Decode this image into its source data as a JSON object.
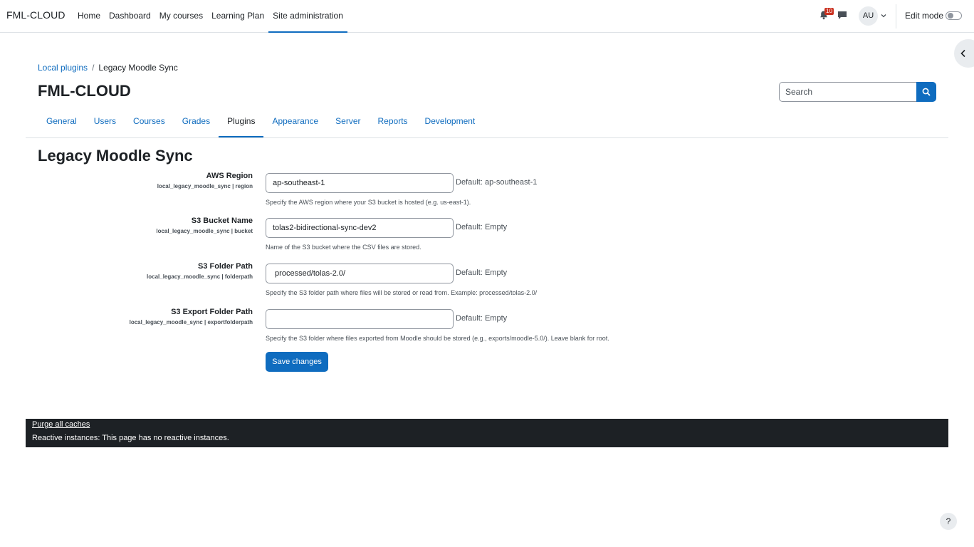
{
  "navbar": {
    "brand": "FML-CLOUD",
    "items": [
      {
        "label": "Home"
      },
      {
        "label": "Dashboard"
      },
      {
        "label": "My courses"
      },
      {
        "label": "Learning Plan"
      },
      {
        "label": "Site administration"
      }
    ],
    "active_item": "Site administration",
    "notification_count": "10",
    "avatar_initials": "AU",
    "edit_mode_label": "Edit mode",
    "icons": [
      "bell-icon",
      "chat-icon",
      "chevron-down-icon",
      "chevron-left-icon"
    ]
  },
  "breadcrumb": {
    "parent": "Local plugins",
    "current": "Legacy Moodle Sync"
  },
  "header": {
    "site_title": "FML-CLOUD"
  },
  "search": {
    "placeholder": "Search"
  },
  "tabs": [
    {
      "label": "General"
    },
    {
      "label": "Users"
    },
    {
      "label": "Courses"
    },
    {
      "label": "Grades"
    },
    {
      "label": "Plugins"
    },
    {
      "label": "Appearance"
    },
    {
      "label": "Server"
    },
    {
      "label": "Reports"
    },
    {
      "label": "Development"
    }
  ],
  "active_tab": "Plugins",
  "page_heading": "Legacy Moodle Sync",
  "settings": [
    {
      "title": "AWS Region",
      "key": "local_legacy_moodle_sync | region",
      "value": "ap-southeast-1",
      "default": "Default: ap-southeast-1",
      "description": "Specify the AWS region where your S3 bucket is hosted (e.g. us-east-1)."
    },
    {
      "title": "S3 Bucket Name",
      "key": "local_legacy_moodle_sync | bucket",
      "value": "tolas2-bidirectional-sync-dev2",
      "default": "Default: Empty",
      "description": "Name of the S3 bucket where the CSV files are stored."
    },
    {
      "title": "S3 Folder Path",
      "key": "local_legacy_moodle_sync | folderpath",
      "value": " processed/tolas-2.0/",
      "default": "Default: Empty",
      "description": "Specify the S3 folder path where files will be stored or read from. Example: processed/tolas-2.0/"
    },
    {
      "title": "S3 Export Folder Path",
      "key": "local_legacy_moodle_sync | exportfolderpath",
      "value": "",
      "default": "Default: Empty",
      "description": "Specify the S3 folder where files exported from Moodle should be stored (e.g., exports/moodle-5.0/). Leave blank for root."
    }
  ],
  "save_label": "Save changes",
  "footer": {
    "purge_label": "Purge all caches",
    "reactive_text": "Reactive instances: This page has no reactive instances."
  },
  "help_label": "?",
  "colors": {
    "primary": "#0f6cbf",
    "text": "#1d2125",
    "footer_bg": "#1d2125",
    "badge": "#ca3120"
  }
}
